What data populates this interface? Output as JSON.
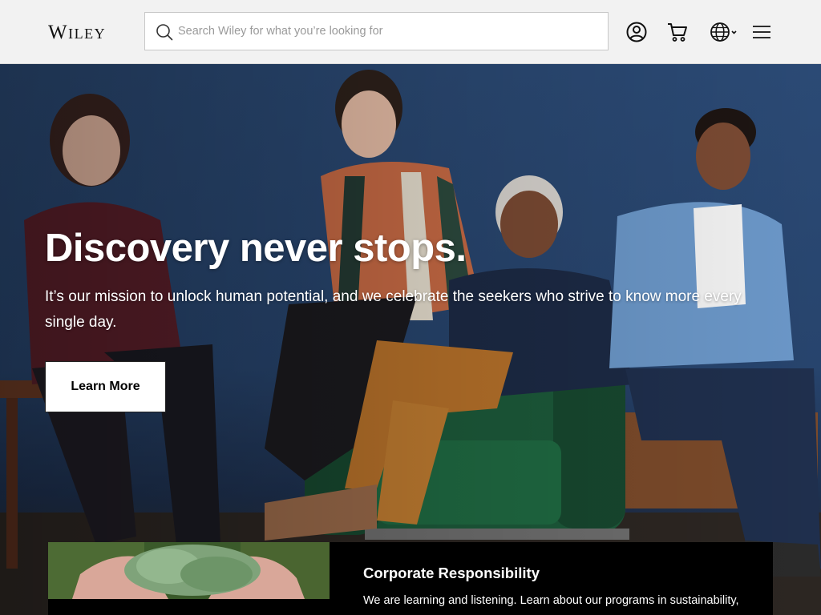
{
  "header": {
    "logo_text": "Wiley",
    "search": {
      "placeholder": "Search Wiley for what you’re looking for",
      "value": ""
    },
    "icons": [
      "search-icon",
      "account-icon",
      "cart-icon",
      "globe-icon",
      "chevron-down-icon",
      "menu-icon"
    ]
  },
  "hero": {
    "title": "Discovery never stops.",
    "description": "It’s our mission to unlock human potential, and we celebrate the seekers who strive to know more every single day.",
    "cta_label": "Learn More"
  },
  "card": {
    "title": "Corporate Responsibility",
    "text": "We are learning and listening. Learn about our programs in sustainability,"
  },
  "colors": {
    "header_bg": "#f2f2f2",
    "hero_bg": "#27446d",
    "card_bg": "#000000",
    "text_light": "#ffffff"
  }
}
